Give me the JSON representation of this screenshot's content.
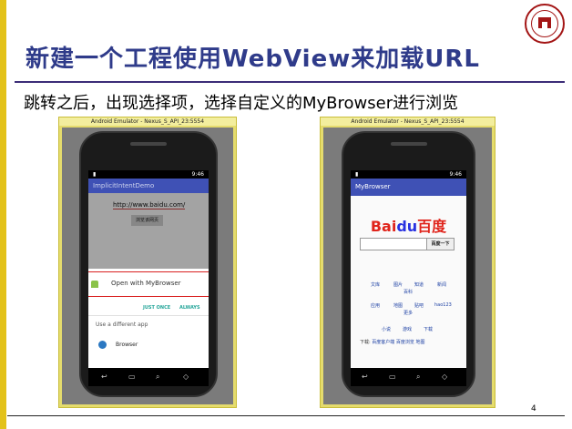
{
  "slide": {
    "title": "新建一个工程使用WebView来加载URL",
    "subtitle": "跳转之后，出现选择项，选择自定义的MyBrowser进行浏览",
    "page_number": "4"
  },
  "left_emulator": {
    "window_title": "Android Emulator - Nexus_S_API_23:5554",
    "status_time": "9:46",
    "app_title": "ImplicitIntentDemo",
    "url_value": "http://www.baidu.com/",
    "browse_button": "浏览该网页",
    "open_with": "Open with MyBrowser",
    "just_once": "JUST ONCE",
    "always": "ALWAYS",
    "use_different_app": "Use a different app",
    "browser_option": "Browser"
  },
  "right_emulator": {
    "window_title": "Android Emulator - Nexus_S_API_23:5554",
    "status_time": "9:46",
    "app_title": "MyBrowser",
    "baidu_logo_left": "Bai",
    "baidu_logo_mid": "du",
    "baidu_logo_right": "百度",
    "search_button": "百度一下",
    "links_row1": [
      "文库",
      "图片",
      "知道",
      "新闻"
    ],
    "links_row1b": "百科",
    "links_row2": [
      "应用",
      "地图",
      "贴吧",
      "hao123"
    ],
    "links_row2b": "更多",
    "links_row3": [
      "小说",
      "游戏",
      "下载"
    ],
    "footer_label": "下载:",
    "footer_links": [
      "百度客户端",
      "百度浏览",
      "地图"
    ]
  },
  "colors": {
    "title_blue": "#2f3b8a",
    "accent_gold": "#e3c21a",
    "app_bar": "#3f51b5",
    "highlight_red": "#d92020",
    "dialog_teal": "#26a69a"
  }
}
